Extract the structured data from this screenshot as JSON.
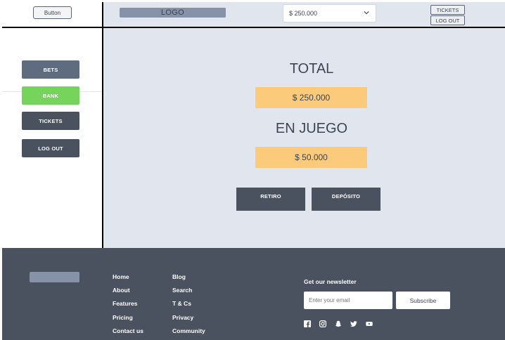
{
  "header": {
    "button_label": "Button",
    "logo_text": "LOGO",
    "balance_value": "$ 250.000",
    "tickets_label": "TICKETS",
    "logout_label": "LOG OUT"
  },
  "sidebar": {
    "items": [
      {
        "label": "BETS",
        "color": "#5f6b7e"
      },
      {
        "label": "BANK",
        "color": "#76d35b"
      },
      {
        "label": "TICKETS",
        "color": "#4a5260"
      },
      {
        "label": "LOG OUT",
        "color": "#4a5260"
      }
    ]
  },
  "main": {
    "total_title": "TOTAL",
    "total_amount": "$ 250.000",
    "ingame_title": "EN JUEGO",
    "ingame_amount": "$ 50.000",
    "withdraw_label": "RETIRO",
    "deposit_label": "DEPÓSITO"
  },
  "footer": {
    "col1": [
      "Home",
      "About",
      "Features",
      "Pricing",
      "Contact us"
    ],
    "col2": [
      "Blog",
      "Search",
      "T & Cs",
      "Privacy",
      "Community"
    ],
    "newsletter_title": "Get our newsletter",
    "email_placeholder": "Enter your email",
    "subscribe_label": "Subscribe",
    "social_icons": [
      "facebook-icon",
      "instagram-icon",
      "snapchat-icon",
      "twitter-icon",
      "youtube-icon"
    ]
  },
  "colors": {
    "accent_amount": "#fbca7b",
    "bank_active": "#76d35b",
    "footer_bg": "#4a5260",
    "main_bg": "#e1e5ee"
  }
}
